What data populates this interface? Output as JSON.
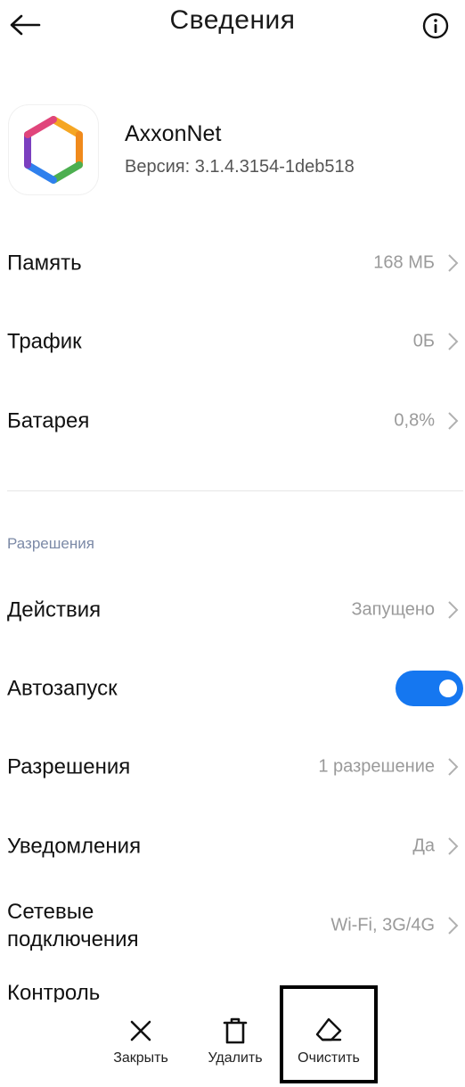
{
  "header": {
    "title": "Сведения"
  },
  "app": {
    "name": "AxxonNet",
    "version": "Версия: 3.1.4.3154-1deb518"
  },
  "rows": [
    {
      "label": "Память",
      "value": "168 МБ"
    },
    {
      "label": "Трафик",
      "value": "0Б"
    },
    {
      "label": "Батарея",
      "value": "0,8%"
    }
  ],
  "section": {
    "title": "Разрешения"
  },
  "perm_rows": {
    "actions": {
      "label": "Действия",
      "value": "Запущено"
    },
    "autostart": {
      "label": "Автозапуск",
      "enabled": true
    },
    "permissions": {
      "label": "Разрешения",
      "value": "1 разрешение"
    },
    "notifications": {
      "label": "Уведомления",
      "value": "Да"
    },
    "network": {
      "label": "Сетевые\nподключения",
      "value": "Wi-Fi, 3G/4G"
    },
    "control": {
      "label": "Контроль"
    }
  },
  "bottom": {
    "close": "Закрыть",
    "delete": "Удалить",
    "clear": "Очистить"
  },
  "colors": {
    "accent": "#1577f0",
    "secondary_text": "#9a9a9a",
    "section": "#7b89a6"
  }
}
